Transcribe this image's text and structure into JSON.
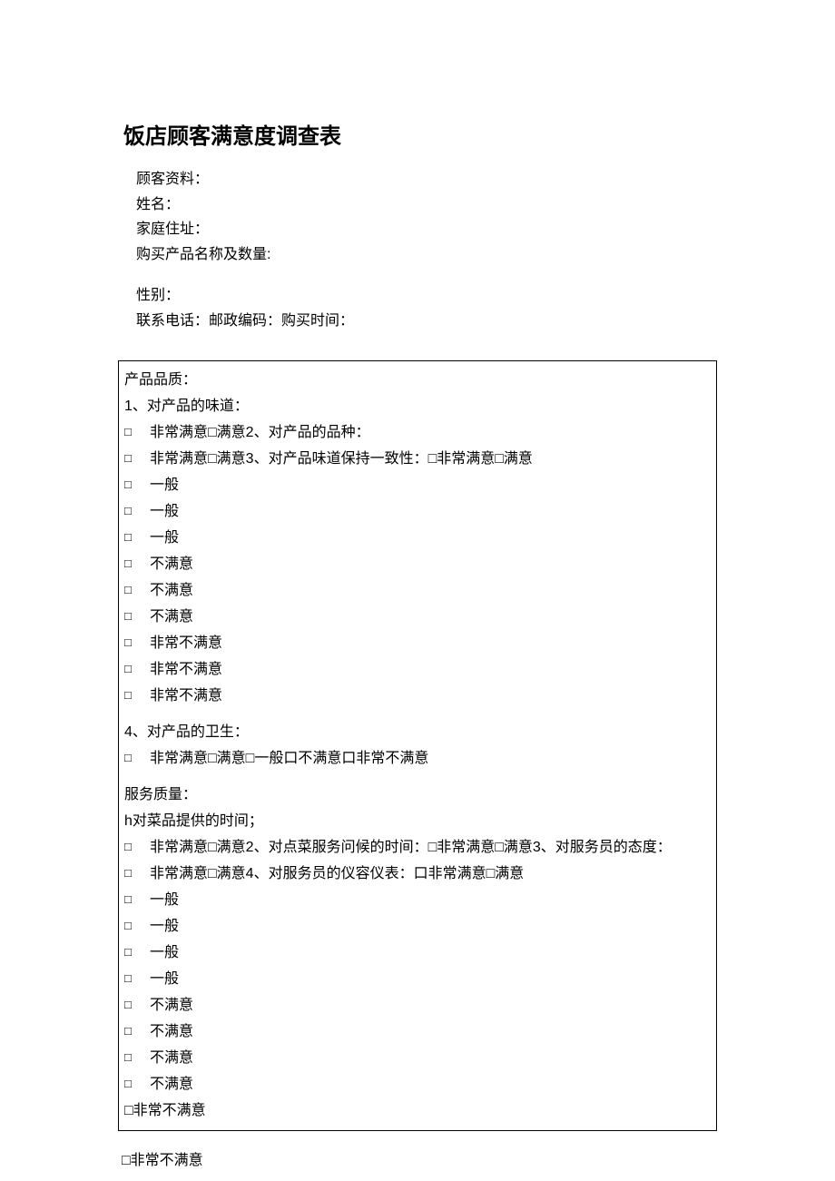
{
  "title": "饭店顾客满意度调查表",
  "customer": {
    "heading": "顾客资料：",
    "name_label": "姓名：",
    "address_label": "家庭住址：",
    "product_label": "购买产品名称及数量:",
    "gender_label": "性别：",
    "contact_line": "联系电话：邮政编码：购买时间："
  },
  "section1": {
    "heading": "产品品质：",
    "q1": "1、对产品的味道：",
    "line1": "非常满意□满意2、对产品的品种：",
    "line2": "非常满意□满意3、对产品味道保持一致性：□非常满意□满意",
    "general": "一般",
    "unsatisfied": "不满意",
    "very_unsatisfied": "非常不满意",
    "q4": "4、对产品的卫生：",
    "q4_line": "非常满意□满意□一般口不满意口非常不满意"
  },
  "section2": {
    "heading": "服务质量：",
    "q1": "h对菜品提供的时间；",
    "line1": "非常满意□满意2、对点菜服务问候的时间：□非常满意□满意3、对服务员的态度：",
    "line2": "非常满意□满意4、对服务员的仪容仪表：口非常满意□满意",
    "general": "一般",
    "unsatisfied": "不满意",
    "vu1": "□非常不满意",
    "vu2": "□非常不满意"
  },
  "checkbox_sym": "□"
}
